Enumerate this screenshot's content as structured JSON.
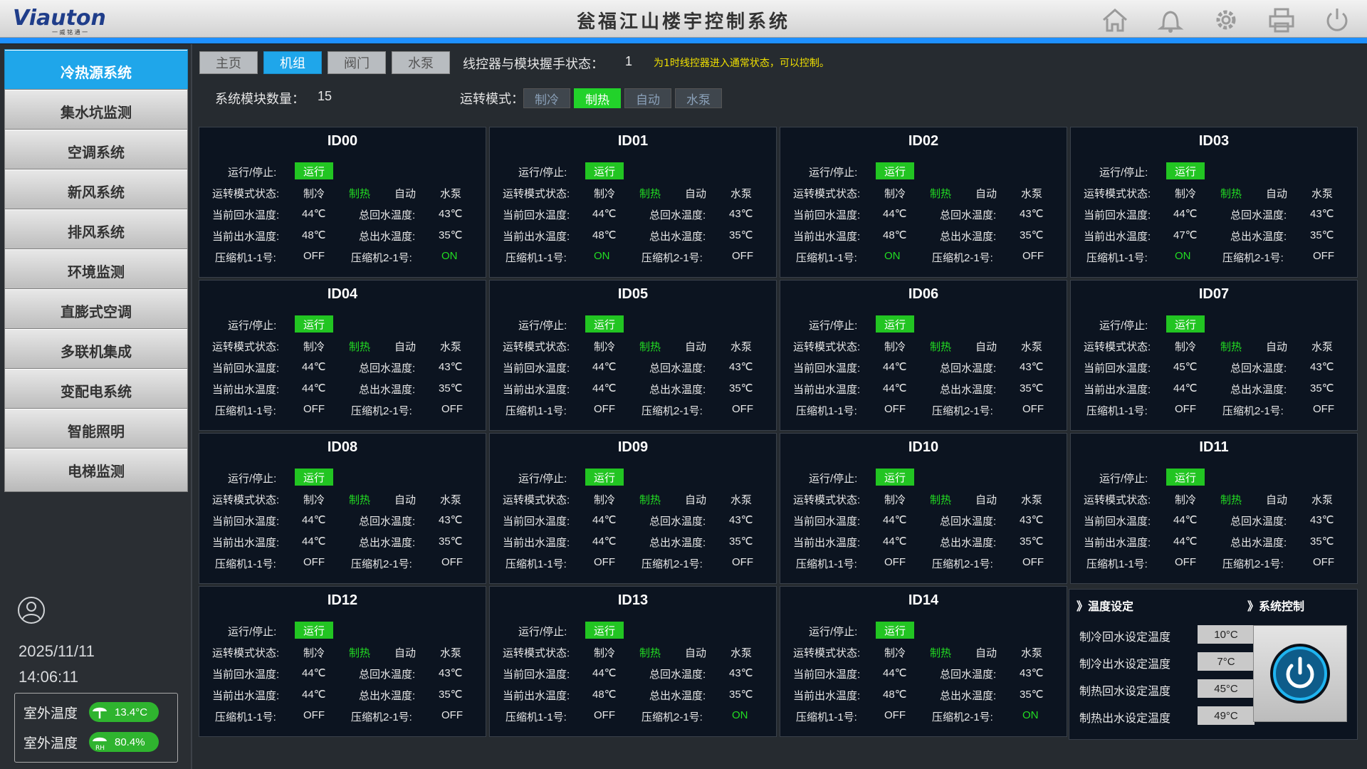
{
  "header": {
    "logo_text": "Viauton",
    "logo_sub": "一 威 铭 通 一",
    "title": "瓮福江山楼宇控制系统",
    "icons": [
      "home-icon",
      "bell-icon",
      "gear-icon",
      "printer-icon",
      "power-icon"
    ]
  },
  "sidebar": {
    "items": [
      {
        "label": "冷热源系统",
        "active": true
      },
      {
        "label": "集水坑监测"
      },
      {
        "label": "空调系统"
      },
      {
        "label": "新风系统"
      },
      {
        "label": "排风系统"
      },
      {
        "label": "环境监测"
      },
      {
        "label": "直膨式空调"
      },
      {
        "label": "多联机集成"
      },
      {
        "label": "变配电系统"
      },
      {
        "label": "智能照明"
      },
      {
        "label": "电梯监测"
      }
    ],
    "date": "2025/11/11",
    "time": "14:06:11",
    "weather": [
      {
        "label": "室外温度",
        "value": "13.4°C",
        "icon": "thermometer-icon"
      },
      {
        "label": "室外温度",
        "value": "80.4%",
        "icon": "humidity-icon"
      }
    ]
  },
  "tabs": [
    {
      "label": "主页"
    },
    {
      "label": "机组",
      "active": true
    },
    {
      "label": "阀门"
    },
    {
      "label": "水泵"
    }
  ],
  "handshake": {
    "label": "线控器与模块握手状态：",
    "value": "1",
    "message": "为1时线控器进入通常状态，可以控制。"
  },
  "module_count": {
    "label": "系统模块数量：",
    "value": "15"
  },
  "mode": {
    "label": "运转模式：",
    "options": [
      {
        "label": "制冷"
      },
      {
        "label": "制热",
        "on": true
      },
      {
        "label": "自动"
      },
      {
        "label": "水泵"
      }
    ]
  },
  "card_labels": {
    "run_stop": "运行/停止:",
    "run_state": "运行",
    "mode_state": "运转模式状态:",
    "modes": [
      "制冷",
      "制热",
      "自动",
      "水泵"
    ],
    "ret_cur": "当前回水温度:",
    "ret_total": "总回水温度:",
    "out_cur": "当前出水温度:",
    "out_total": "总出水温度:",
    "comp1": "压缩机1-1号:",
    "comp2": "压缩机2-1号:"
  },
  "units": [
    {
      "id": "ID00",
      "ret": "44℃",
      "ret_total": "43℃",
      "out": "48℃",
      "out_total": "35℃",
      "c1": "OFF",
      "c2": "ON"
    },
    {
      "id": "ID01",
      "ret": "44℃",
      "ret_total": "43℃",
      "out": "48℃",
      "out_total": "35℃",
      "c1": "ON",
      "c2": "OFF"
    },
    {
      "id": "ID02",
      "ret": "44℃",
      "ret_total": "43℃",
      "out": "48℃",
      "out_total": "35℃",
      "c1": "ON",
      "c2": "OFF"
    },
    {
      "id": "ID03",
      "ret": "44℃",
      "ret_total": "43℃",
      "out": "47℃",
      "out_total": "35℃",
      "c1": "ON",
      "c2": "OFF"
    },
    {
      "id": "ID04",
      "ret": "44℃",
      "ret_total": "43℃",
      "out": "44℃",
      "out_total": "35℃",
      "c1": "OFF",
      "c2": "OFF"
    },
    {
      "id": "ID05",
      "ret": "44℃",
      "ret_total": "43℃",
      "out": "44℃",
      "out_total": "35℃",
      "c1": "OFF",
      "c2": "OFF"
    },
    {
      "id": "ID06",
      "ret": "44℃",
      "ret_total": "43℃",
      "out": "44℃",
      "out_total": "35℃",
      "c1": "OFF",
      "c2": "OFF"
    },
    {
      "id": "ID07",
      "ret": "45℃",
      "ret_total": "43℃",
      "out": "44℃",
      "out_total": "35℃",
      "c1": "OFF",
      "c2": "OFF"
    },
    {
      "id": "ID08",
      "ret": "44℃",
      "ret_total": "43℃",
      "out": "44℃",
      "out_total": "35℃",
      "c1": "OFF",
      "c2": "OFF"
    },
    {
      "id": "ID09",
      "ret": "44℃",
      "ret_total": "43℃",
      "out": "44℃",
      "out_total": "35℃",
      "c1": "OFF",
      "c2": "OFF"
    },
    {
      "id": "ID10",
      "ret": "44℃",
      "ret_total": "43℃",
      "out": "44℃",
      "out_total": "35℃",
      "c1": "OFF",
      "c2": "OFF"
    },
    {
      "id": "ID11",
      "ret": "44℃",
      "ret_total": "43℃",
      "out": "44℃",
      "out_total": "35℃",
      "c1": "OFF",
      "c2": "OFF"
    },
    {
      "id": "ID12",
      "ret": "44℃",
      "ret_total": "43℃",
      "out": "44℃",
      "out_total": "35℃",
      "c1": "OFF",
      "c2": "OFF"
    },
    {
      "id": "ID13",
      "ret": "44℃",
      "ret_total": "43℃",
      "out": "48℃",
      "out_total": "35℃",
      "c1": "OFF",
      "c2": "ON"
    },
    {
      "id": "ID14",
      "ret": "44℃",
      "ret_total": "43℃",
      "out": "48℃",
      "out_total": "35℃",
      "c1": "OFF",
      "c2": "ON"
    }
  ],
  "temp_settings": {
    "title": "》温度设定",
    "items": [
      {
        "label": "制冷回水设定温度",
        "value": "10°C"
      },
      {
        "label": "制冷出水设定温度",
        "value": "7°C"
      },
      {
        "label": "制热回水设定温度",
        "value": "45°C"
      },
      {
        "label": "制热出水设定温度",
        "value": "49°C"
      }
    ]
  },
  "system_control": {
    "title": "》系统控制",
    "icon": "power-icon"
  },
  "colors": {
    "accent": "#1fa6ea",
    "run_green": "#22c522",
    "on_green": "#22dd22",
    "card_bg": "#0c1420",
    "warn_yellow": "#f0e000"
  }
}
